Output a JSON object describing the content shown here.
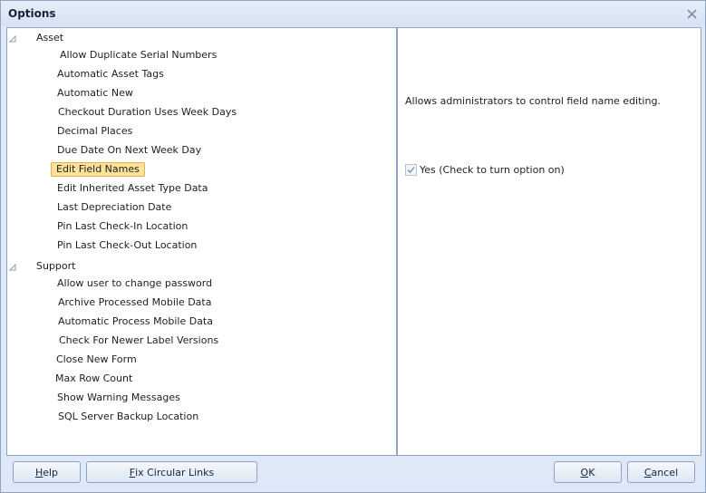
{
  "window": {
    "title": "Options",
    "close_icon": "close-icon"
  },
  "tree": {
    "groups": [
      {
        "label": "Asset",
        "items": [
          "Allow Duplicate Serial Numbers",
          "Automatic Asset Tags",
          "Automatic New",
          "Checkout Duration Uses Week Days",
          "Decimal Places",
          "Due Date On Next Week Day",
          "Edit Field Names",
          "Edit Inherited Asset Type Data",
          "Last Depreciation Date",
          "Pin Last Check-In Location",
          "Pin Last Check-Out Location"
        ]
      },
      {
        "label": "Support",
        "items": [
          "Allow user to change password",
          "Archive Processed Mobile Data",
          "Automatic Process Mobile Data",
          "Check For Newer Label Versions",
          "Close New Form",
          "Max Row Count",
          "Show Warning Messages",
          "SQL Server Backup Location"
        ]
      }
    ],
    "selected_item": "Edit Field Names"
  },
  "detail": {
    "description": "Allows administrators to control field name editing.",
    "checkbox_label": "Yes (Check to turn option on)",
    "checked": true
  },
  "buttons": {
    "help": {
      "mnemonic": "H",
      "rest": "elp"
    },
    "fix": {
      "mnemonic": "F",
      "rest": "ix Circular Links"
    },
    "ok": {
      "mnemonic": "O",
      "rest": "K"
    },
    "cancel": {
      "mnemonic": "C",
      "rest": "ancel"
    }
  },
  "colors": {
    "accent": "#ffe29a",
    "frame": "#dfe8f6",
    "border": "#8fa4c2"
  }
}
